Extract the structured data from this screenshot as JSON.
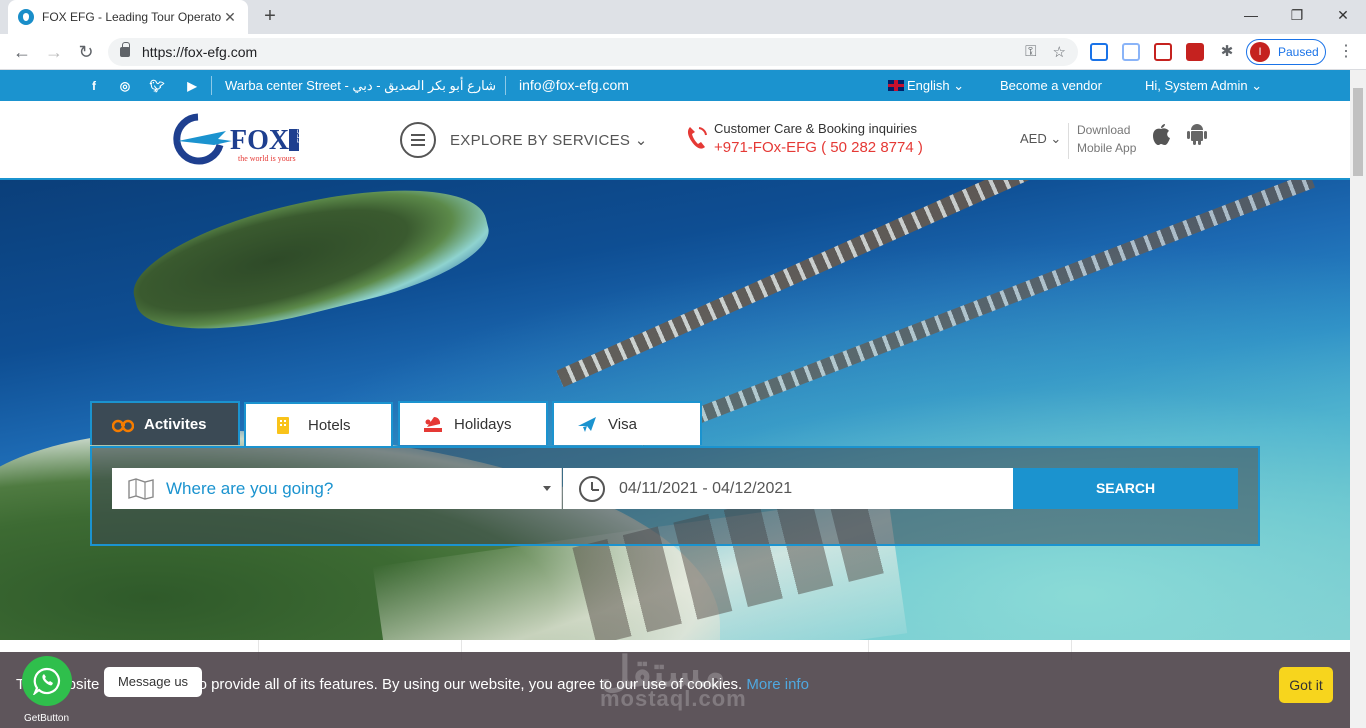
{
  "browser": {
    "tab_title": "FOX EFG - Leading Tour Operator",
    "url": "https://fox-efg.com",
    "profile_initial": "I",
    "profile_status": "Paused"
  },
  "topbar": {
    "address": "Warba center Street - شارع أبو بكر الصديق - دبي",
    "email": "info@fox-efg.com",
    "language": "English",
    "vendor": "Become a vendor",
    "user": "Hi, System Admin"
  },
  "header": {
    "logo_text": "FOX",
    "logo_sub": "EFG",
    "logo_tagline": "the world is yours",
    "explore": "EXPLORE BY SERVICES",
    "care_label": "Customer Care & Booking inquiries",
    "care_phone": "+971-FOx-EFG ( 50 282 8774 )",
    "currency": "AED",
    "download_line1": "Download",
    "download_line2": "Mobile App"
  },
  "search": {
    "tabs": [
      "Activites",
      "Hotels",
      "Holidays",
      "Visa"
    ],
    "active_tab": "Activites",
    "destination_placeholder": "Where are you going?",
    "dates": "04/11/2021 - 04/12/2021",
    "button": "SEARCH"
  },
  "cookie": {
    "message": "This website uses cookies to provide all of its features. By using our website, you agree to our use of cookies.",
    "more": "More info",
    "button": "Got it"
  },
  "whatsapp": {
    "tooltip": "Message us",
    "label": "GetButton"
  },
  "watermark": {
    "arabic": "مستقل",
    "latin": "mostaql.com"
  },
  "colors": {
    "brand_blue": "#1b93cf",
    "phone_red": "#e53935",
    "gotit_yellow": "#f7d51d",
    "whatsapp_green": "#2fbf4c"
  }
}
